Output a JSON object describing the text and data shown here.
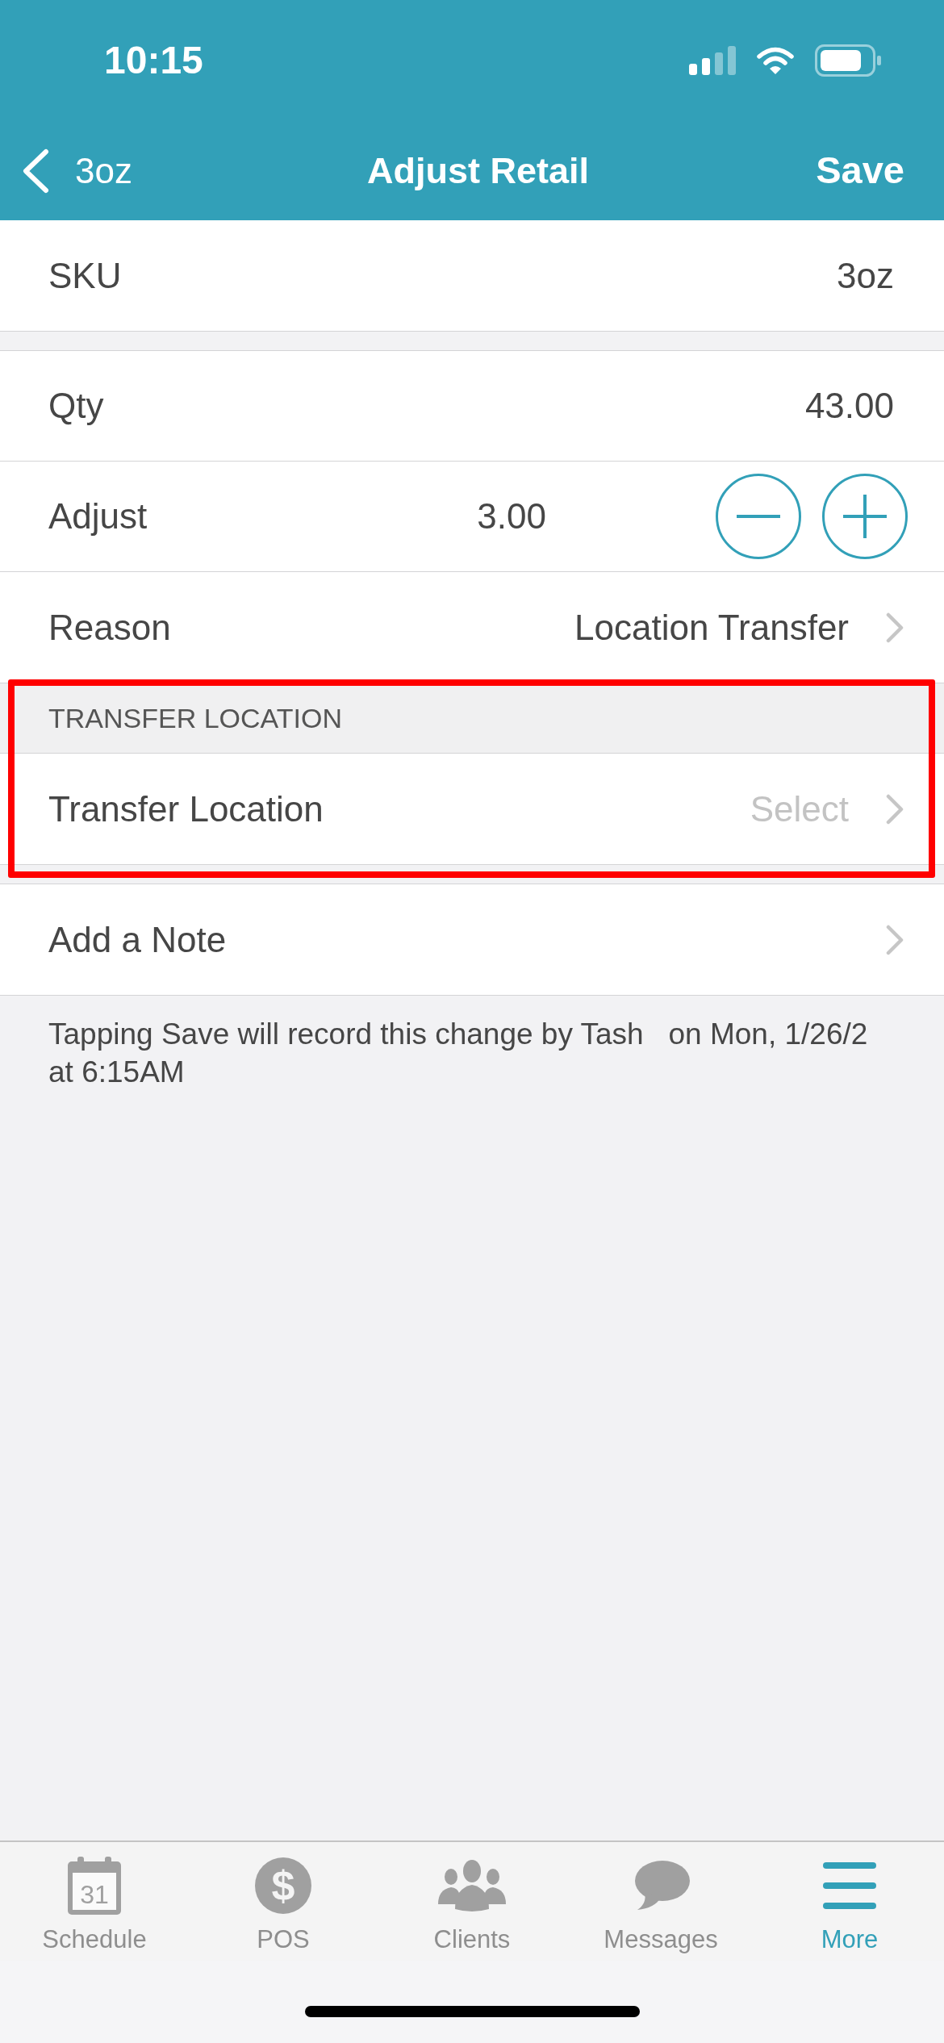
{
  "status_bar": {
    "time": "10:15"
  },
  "nav_bar": {
    "back_label": "3oz",
    "title": "Adjust Retail",
    "action": "Save"
  },
  "sections": [
    {
      "rows": [
        {
          "kind": "value",
          "label": "SKU",
          "value": "3oz"
        }
      ]
    },
    {
      "rows": [
        {
          "kind": "value",
          "label": "Qty",
          "value": "43.00"
        },
        {
          "kind": "stepper",
          "label": "Adjust",
          "value": "3.00"
        },
        {
          "kind": "disclosure",
          "label": "Reason",
          "value": "Location Transfer"
        }
      ]
    },
    {
      "header": "TRANSFER LOCATION",
      "highlighted": true,
      "rows": [
        {
          "kind": "disclosure",
          "label": "Transfer Location",
          "placeholder": "Select"
        }
      ]
    },
    {
      "rows": [
        {
          "kind": "disclosure",
          "label": "Add a Note"
        }
      ]
    }
  ],
  "footer_note": "Tapping Save will record this change by Tash   on Mon, 1/26/2\nat 6:15AM",
  "tabs": [
    {
      "label": "Schedule",
      "icon_text": "31",
      "selected": false
    },
    {
      "label": "POS",
      "icon_text": "$",
      "selected": false
    },
    {
      "label": "Clients",
      "selected": false
    },
    {
      "label": "Messages",
      "selected": false
    },
    {
      "label": "More",
      "selected": true
    }
  ]
}
